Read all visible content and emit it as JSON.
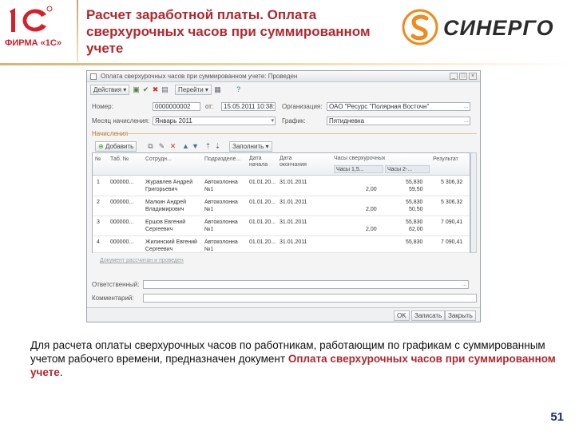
{
  "header": {
    "logo_firm": "ФИРМА «1С»",
    "title": "Расчет заработной платы. Оплата сверхурочных часов при суммированном учете",
    "brand": "СИНЕРГО",
    "colors": {
      "title": "#b0282e",
      "logo_red": "#d4202a",
      "synergy_orange": "#f08a1a"
    }
  },
  "window": {
    "title": "Оплата сверхурочных часов при суммированном учете: Проведен",
    "toolbar": {
      "actions": "Действия",
      "goto": "Перейти"
    },
    "fields": {
      "number_label": "Номер:",
      "number_value": "0000000002",
      "date_label": "от:",
      "date_value": "15.05.2011 10:38:",
      "org_label": "Организация:",
      "org_value": "ОАО \"Ресурс \"Полярная Восточн\"",
      "period_label": "Месяц начисления:",
      "period_value": "Январь 2011",
      "schedule_label": "График:",
      "schedule_value": "Пятидневка"
    },
    "section_title": "Начисления",
    "table_toolbar": {
      "add": "Добавить",
      "fill": "Заполнить"
    },
    "grid": {
      "headers": {
        "n": "№",
        "tab": "Таб. №",
        "employee": "Сотрудн...",
        "department": "Подразделе...",
        "date_start": "Дата начала",
        "date_end": "Дата окончания",
        "hours_group": "Часы сверхурочных",
        "hours_1_5": "Часы 1,5...",
        "hours_2": "Часы 2-...",
        "result": "Результат"
      },
      "rows": [
        {
          "n": "1",
          "tab": "000000...",
          "name1": "Журавлев Андрей",
          "name2": "Григорьевич",
          "dep1": "Автоколонна",
          "dep2": "№1",
          "d1": "01.01.20...",
          "d2": "31.01.2011",
          "h15": "2,00",
          "v1": "55,830",
          "v2": "59,50",
          "res": "5 306,32"
        },
        {
          "n": "2",
          "tab": "000000...",
          "name1": "Малкин Андрей",
          "name2": "Владимирович",
          "dep1": "Автоколонна",
          "dep2": "№1",
          "d1": "01.01.20...",
          "d2": "31.01.2011",
          "h15": "2,00",
          "v1": "55,830",
          "v2": "50,50",
          "res": "5 306,32"
        },
        {
          "n": "3",
          "tab": "000000...",
          "name1": "Ершов Евгений",
          "name2": "Сергеевич",
          "dep1": "Автоколонна",
          "dep2": "№1",
          "d1": "01.01.20...",
          "d2": "31.01.2011",
          "h15": "2,00",
          "v1": "55,830",
          "v2": "62,00",
          "res": "7 090,41"
        },
        {
          "n": "4",
          "tab": "000000...",
          "name1": "Жилинский Евгений",
          "name2": "Сергеевич",
          "dep1": "Автоколонна",
          "dep2": "№1",
          "d1": "01.01.20...",
          "d2": "31.01.2011",
          "h15": "",
          "v1": "55,830",
          "v2": "",
          "res": "7 090,41"
        }
      ]
    },
    "doc_link": "Документ рассчитан и проведен",
    "responsible_label": "Ответственный:",
    "comment_label": "Комментарий:",
    "footer": {
      "ok": "OK",
      "save": "Записать",
      "close": "Закрыть"
    }
  },
  "description": {
    "text": "Для расчета оплаты сверхурочных часов по работникам, работающим по графикам с суммированным учетом рабочего времени, предназначен документ ",
    "emphasis": "Оплата сверхурочных часов при суммированном учете",
    "end": "."
  },
  "page_number": "51"
}
